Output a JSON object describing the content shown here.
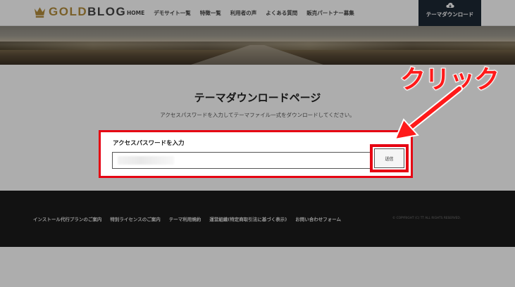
{
  "header": {
    "logo_text": "GOLDBLOG",
    "nav": [
      "HOME",
      "デモサイト一覧",
      "特徴一覧",
      "利用者の声",
      "よくある質問",
      "販売パートナー募集"
    ],
    "download_button": "テーマダウンロード"
  },
  "main": {
    "title": "テーマダウンロードページ",
    "description": "アクセスパスワードを入力してテーマファイル一式をダウンロードしてください。",
    "form": {
      "label": "アクセスパスワードを入力",
      "input_value": "",
      "submit_label": "送信"
    }
  },
  "annotation": {
    "text": "クリック",
    "color": "#ff1a1a"
  },
  "footer": {
    "links": [
      "インストール代行プランのご案内",
      "特別ライセンスのご案内",
      "テーマ利用規約",
      "運営組織(特定商取引法に基づく表示)",
      "お問い合わせフォーム"
    ],
    "copyright": "© COPYRIGHT (C) TT ALL RIGHTS RESERVED."
  },
  "colors": {
    "accent_gold": "#b38d3c",
    "download_bg": "#1d2834",
    "highlight_red": "#e60012",
    "footer_bg": "#1b1b1b"
  }
}
